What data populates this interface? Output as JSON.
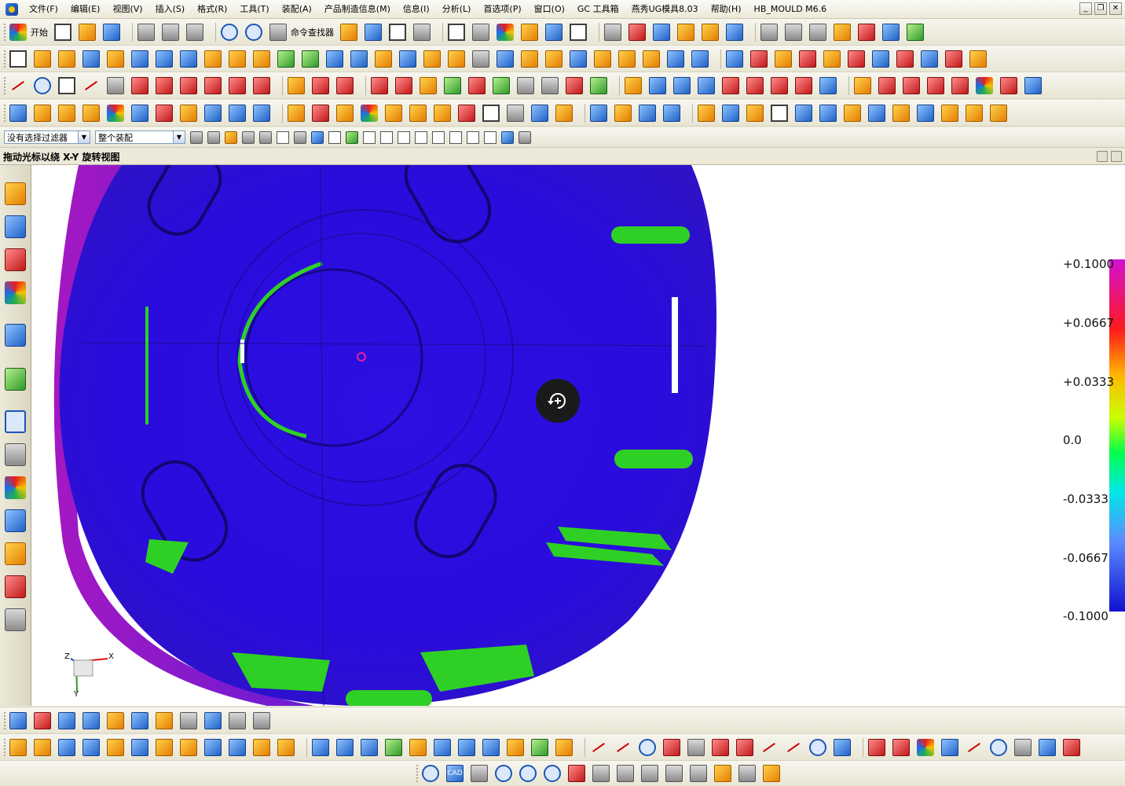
{
  "menubar": {
    "items": [
      "文件(F)",
      "编辑(E)",
      "视图(V)",
      "插入(S)",
      "格式(R)",
      "工具(T)",
      "装配(A)",
      "产品制造信息(M)",
      "信息(I)",
      "分析(L)",
      "首选项(P)",
      "窗口(O)",
      "GC 工具箱",
      "燕秀UG模具8.03",
      "帮助(H)",
      "HB_MOULD M6.6"
    ],
    "win_min": "_",
    "win_restore": "❐",
    "win_close": "✕"
  },
  "toolbar1": {
    "start_label": "开始",
    "command_finder_label": "命令查找器"
  },
  "selection_bar": {
    "filter_value": "没有选择过滤器",
    "scope_value": "整个装配"
  },
  "cue_line": {
    "text": "拖动光标以绕 X-Y 旋转视图"
  },
  "viewport": {
    "scale_labels": [
      "+0.1000",
      "+0.0667",
      "+0.0333",
      "0.0",
      "-0.0333",
      "-0.0667",
      "-0.1000"
    ],
    "triad_x": "X",
    "triad_y": "Y",
    "triad_z": "Z"
  },
  "bottom_bar": {
    "cad_label": "CAD"
  },
  "colors": {
    "part_body": "#2a0ce0",
    "part_rim": "#8a1fc6",
    "deviation_green": "#2fd025",
    "background": "#ffffff"
  }
}
